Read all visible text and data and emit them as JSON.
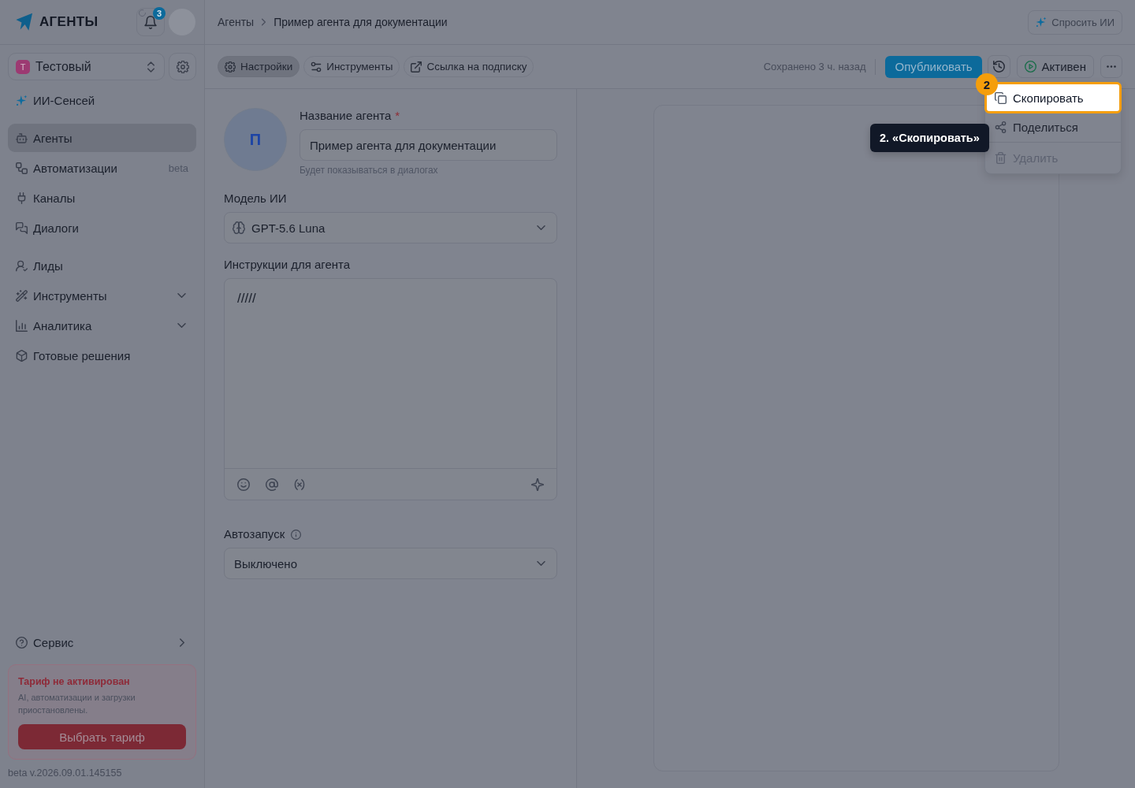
{
  "app_header": {
    "logo_text": "АГЕНТЫ",
    "notification_count": "3"
  },
  "workspace_switcher": {
    "initial": "Т",
    "name": "Тестовый"
  },
  "assistant_link": {
    "label": "ИИ-Сенсей"
  },
  "sidebar": {
    "groups": [
      {
        "items": [
          {
            "label": "Агенты",
            "kind": "link",
            "selected": true
          },
          {
            "label": "Автоматизации",
            "kind": "link",
            "selected": false,
            "badge": "beta"
          },
          {
            "label": "Каналы",
            "kind": "link",
            "selected": false
          },
          {
            "label": "Диалоги",
            "kind": "link",
            "selected": false
          }
        ]
      },
      {
        "items": [
          {
            "label": "Лиды",
            "kind": "link",
            "selected": false
          },
          {
            "label": "Инструменты",
            "kind": "group",
            "selected": false,
            "expanded": false
          },
          {
            "label": "Аналитика",
            "kind": "group",
            "selected": false,
            "expanded": false
          },
          {
            "label": "Готовые решения",
            "kind": "link",
            "selected": false
          }
        ]
      }
    ],
    "service_item": {
      "label": "Сервис"
    }
  },
  "plan_notice": {
    "title": "Тариф не активирован",
    "text": "AI, автоматизации и загрузки приостановлены.",
    "button": "Выбрать тариф"
  },
  "version": "beta v.2026.09.01.145155",
  "breadcrumbs": [
    "Агенты",
    "Пример агента для документации"
  ],
  "ask_ai_button": "Спросить ИИ",
  "toolbar": {
    "tabs": [
      {
        "label": "Настройки",
        "selected": true
      },
      {
        "label": "Инструменты",
        "selected": false
      },
      {
        "label": "Ссылка на подписку",
        "selected": false
      }
    ],
    "saved_status": "Сохранено 3 ч. назад",
    "publish_button": "Опубликовать",
    "status_button": "Активен"
  },
  "more_menu": {
    "items": [
      {
        "label": "Скопировать",
        "highlighted": true,
        "disabled": false
      },
      {
        "label": "Поделиться",
        "highlighted": false,
        "disabled": false
      },
      {
        "label": "Удалить",
        "highlighted": false,
        "disabled": true
      }
    ]
  },
  "tour": {
    "step": "2",
    "tooltip": "2. «Скопировать»"
  },
  "form": {
    "avatar_initial": "П",
    "name_field": {
      "label": "Название агента",
      "required_mark": "*",
      "value": "Пример агента для документации",
      "hint": "Будет показываться в диалогах"
    },
    "model_field": {
      "label": "Модель ИИ",
      "value": "GPT-5.6 Luna"
    },
    "instructions_field": {
      "label": "Инструкции для агента",
      "value": "/////"
    },
    "autostart_field": {
      "label": "Автозапуск",
      "value": "Выключено"
    }
  }
}
